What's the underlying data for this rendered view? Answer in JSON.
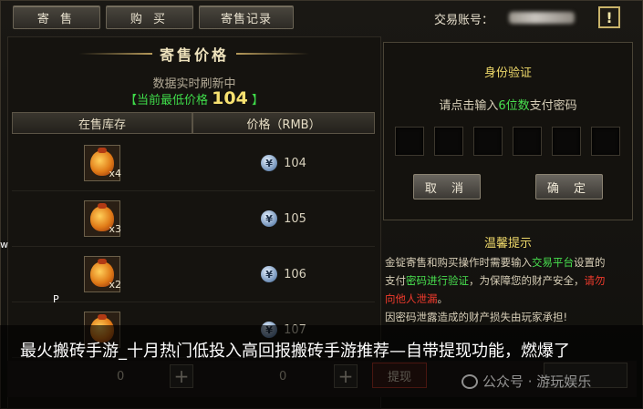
{
  "tabs": [
    "寄 售",
    "购 买",
    "寄售记录"
  ],
  "account": {
    "label": "交易账号："
  },
  "alert_icon_text": "!",
  "left_panel": {
    "title": "寄售价格",
    "refresh_text": "数据实时刷新中",
    "lowest_label": "【当前最低价格",
    "lowest_value": "104",
    "lowest_suffix": "】",
    "columns": [
      "在售库存",
      "价格（RMB）"
    ],
    "rows": [
      {
        "qty": "x4",
        "price": "104"
      },
      {
        "qty": "x3",
        "price": "105"
      },
      {
        "qty": "x2",
        "price": "106"
      },
      {
        "qty": "",
        "price": "107"
      }
    ]
  },
  "verify": {
    "title": "身份验证",
    "hint_pre": "请点击输入",
    "hint_highlight": "6位数",
    "hint_post": "支付密码",
    "cancel": "取 消",
    "confirm": "确 定"
  },
  "tips": {
    "title": "温馨提示",
    "line1_a": "金锭寄售和购买操作时需要输入",
    "line1_b": "交易平台",
    "line1_c": "设置的",
    "line2_a": "支付",
    "line2_b": "密码进行验证",
    "line2_c": "，为保障您的财产安全，",
    "line2_d": "请勿",
    "line3": "向他人泄漏",
    "line3_end": "。",
    "line4": "因密码泄露造成的财产损失由玩家承担!"
  },
  "bottom": {
    "zero1": "0",
    "zero2": "0",
    "withdraw": "提现",
    "plus": "+"
  },
  "caption": "最火搬砖手游_十月热门低投入高回报搬砖手游推荐—自带提现功能，燃爆了",
  "watermark": "公众号 · 游玩娱乐",
  "stray": {
    "w": "w",
    "p": "P"
  },
  "colors": {
    "highlight_green": "#48e04f",
    "gold": "#efd96a",
    "warning_red": "#ef3a2c"
  }
}
